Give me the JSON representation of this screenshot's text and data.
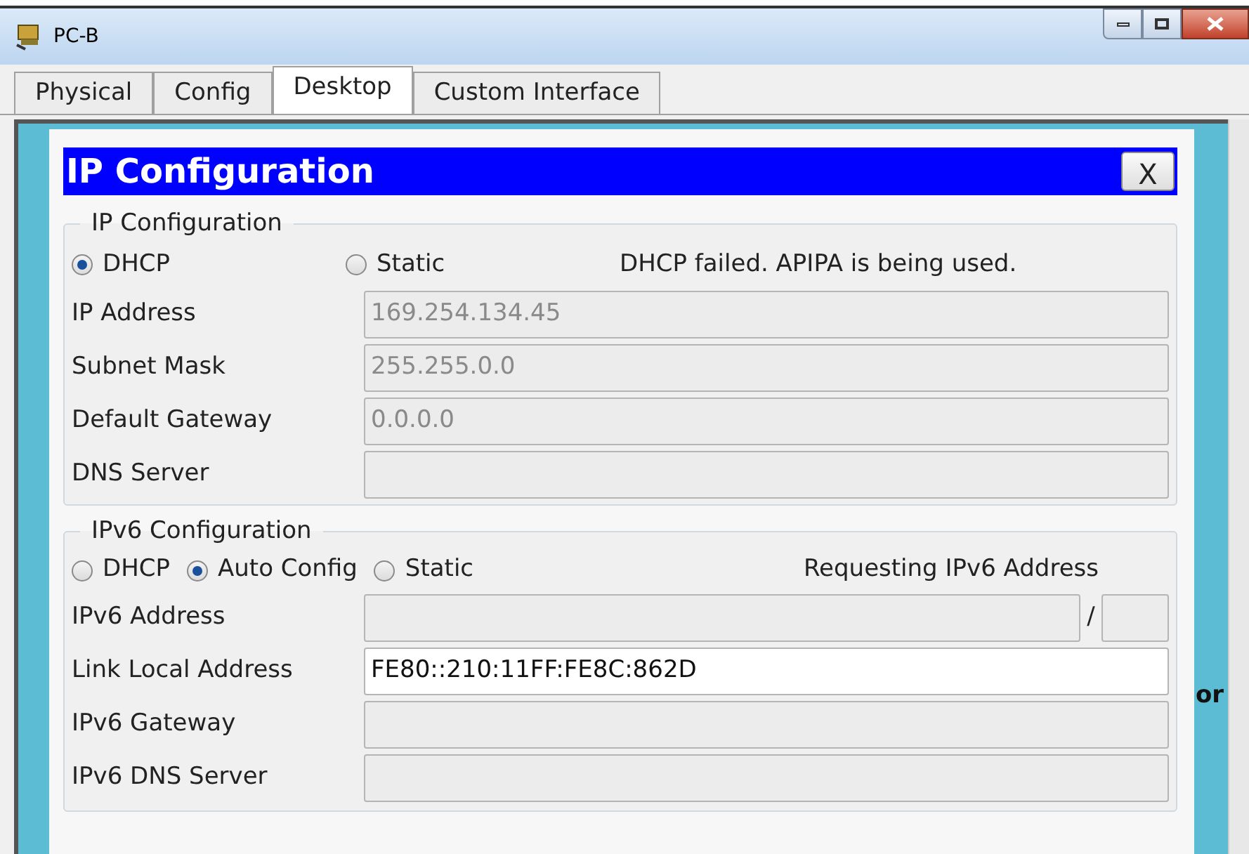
{
  "window": {
    "title": "PC-B"
  },
  "tabs": [
    {
      "label": "Physical",
      "selected": false
    },
    {
      "label": "Config",
      "selected": false
    },
    {
      "label": "Desktop",
      "selected": true
    },
    {
      "label": "Custom Interface",
      "selected": false
    }
  ],
  "dialog": {
    "title": "IP Configuration",
    "close": "X",
    "ipv4": {
      "legend": "IP Configuration",
      "modes": [
        {
          "label": "DHCP",
          "selected": true
        },
        {
          "label": "Static",
          "selected": false
        }
      ],
      "status": "DHCP failed. APIPA is being used.",
      "fields": [
        {
          "label": "IP Address",
          "value": "169.254.134.45",
          "disabled": true
        },
        {
          "label": "Subnet Mask",
          "value": "255.255.0.0",
          "disabled": true
        },
        {
          "label": "Default Gateway",
          "value": "0.0.0.0",
          "disabled": true
        },
        {
          "label": "DNS Server",
          "disabled": true
        }
      ]
    },
    "ipv6": {
      "legend": "IPv6 Configuration",
      "modes": [
        {
          "label": "DHCP",
          "selected": false
        },
        {
          "label": "Auto Config",
          "selected": true
        },
        {
          "label": "Static",
          "selected": false
        }
      ],
      "status": "Requesting IPv6 Address",
      "address": {
        "label": "IPv6 Address",
        "separator": "/",
        "disabled": true
      },
      "fields": [
        {
          "label": "Link Local Address",
          "value": "FE80::210:11FF:FE8C:862D",
          "disabled": false
        },
        {
          "label": "IPv6 Gateway",
          "disabled": true
        },
        {
          "label": "IPv6 DNS Server",
          "disabled": true
        }
      ]
    }
  },
  "side_text": "or"
}
